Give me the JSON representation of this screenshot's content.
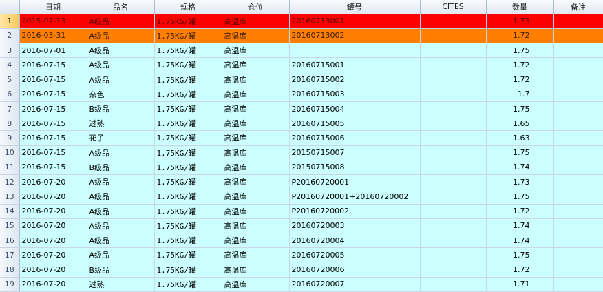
{
  "colors": {
    "row_default": "#ccffff",
    "row_red": "#ff0000",
    "row_orange": "#ff8000",
    "header": "#dfe8f3"
  },
  "columns": [
    "日期",
    "品名",
    "规格",
    "仓位",
    "罐号",
    "CITES",
    "数量",
    "备注"
  ],
  "rows": [
    {
      "n": "1",
      "date": "2015-07-13",
      "name": "A级品",
      "spec": "1.75KG/罐",
      "loc": "高温库",
      "can": "20160713001",
      "cites": "",
      "qty": "1.73",
      "note": "",
      "status": "red"
    },
    {
      "n": "2",
      "date": "2016-03-31",
      "name": "A级品",
      "spec": "1.75KG/罐",
      "loc": "高温库",
      "can": "20160713002",
      "cites": "",
      "qty": "1.72",
      "note": "",
      "status": "orange"
    },
    {
      "n": "3",
      "date": "2016-07-01",
      "name": "A级品",
      "spec": "1.75KG/罐",
      "loc": "高温库",
      "can": "",
      "cites": "",
      "qty": "1.75",
      "note": "",
      "status": "normal"
    },
    {
      "n": "4",
      "date": "2016-07-15",
      "name": "A级品",
      "spec": "1.75KG/罐",
      "loc": "高温库",
      "can": "20160715001",
      "cites": "",
      "qty": "1.72",
      "note": "",
      "status": "normal"
    },
    {
      "n": "5",
      "date": "2016-07-15",
      "name": "A级品",
      "spec": "1.75KG/罐",
      "loc": "高温库",
      "can": "20160715002",
      "cites": "",
      "qty": "1.72",
      "note": "",
      "status": "normal"
    },
    {
      "n": "6",
      "date": "2016-07-15",
      "name": "杂色",
      "spec": "1.75KG/罐",
      "loc": "高温库",
      "can": "20160715003",
      "cites": "",
      "qty": "1.7",
      "note": "",
      "status": "normal"
    },
    {
      "n": "7",
      "date": "2016-07-15",
      "name": "B级品",
      "spec": "1.75KG/罐",
      "loc": "高温库",
      "can": "20160715004",
      "cites": "",
      "qty": "1.75",
      "note": "",
      "status": "normal"
    },
    {
      "n": "8",
      "date": "2016-07-15",
      "name": "过熟",
      "spec": "1.75KG/罐",
      "loc": "高温库",
      "can": "20160715005",
      "cites": "",
      "qty": "1.65",
      "note": "",
      "status": "normal"
    },
    {
      "n": "9",
      "date": "2016-07-15",
      "name": "花子",
      "spec": "1.75KG/罐",
      "loc": "高温库",
      "can": "20160715006",
      "cites": "",
      "qty": "1.63",
      "note": "",
      "status": "normal"
    },
    {
      "n": "10",
      "date": "2016-07-15",
      "name": "A级品",
      "spec": "1.75KG/罐",
      "loc": "高温库",
      "can": "20150715007",
      "cites": "",
      "qty": "1.75",
      "note": "",
      "status": "normal"
    },
    {
      "n": "11",
      "date": "2016-07-15",
      "name": "B级品",
      "spec": "1.75KG/罐",
      "loc": "高温库",
      "can": "20150715008",
      "cites": "",
      "qty": "1.74",
      "note": "",
      "status": "normal"
    },
    {
      "n": "12",
      "date": "2016-07-20",
      "name": "A级品",
      "spec": "1.75KG/罐",
      "loc": "高温库",
      "can": "P20160720001",
      "cites": "",
      "qty": "1.73",
      "note": "",
      "status": "normal"
    },
    {
      "n": "13",
      "date": "2016-07-20",
      "name": "A级品",
      "spec": "1.75KG/罐",
      "loc": "高温库",
      "can": "P20160720001+20160720002",
      "cites": "",
      "qty": "1.75",
      "note": "",
      "status": "normal"
    },
    {
      "n": "14",
      "date": "2016-07-20",
      "name": "A级品",
      "spec": "1.75KG/罐",
      "loc": "高温库",
      "can": "P20160720002",
      "cites": "",
      "qty": "1.72",
      "note": "",
      "status": "normal"
    },
    {
      "n": "15",
      "date": "2016-07-20",
      "name": "A级品",
      "spec": "1.75KG/罐",
      "loc": "高温库",
      "can": "20160720003",
      "cites": "",
      "qty": "1.74",
      "note": "",
      "status": "normal"
    },
    {
      "n": "16",
      "date": "2016-07-20",
      "name": "A级品",
      "spec": "1.75KG/罐",
      "loc": "高温库",
      "can": "20160720004",
      "cites": "",
      "qty": "1.74",
      "note": "",
      "status": "normal"
    },
    {
      "n": "17",
      "date": "2016-07-20",
      "name": "A级品",
      "spec": "1.75KG/罐",
      "loc": "高温库",
      "can": "20160720005",
      "cites": "",
      "qty": "1.75",
      "note": "",
      "status": "normal"
    },
    {
      "n": "18",
      "date": "2016-07-20",
      "name": "B级品",
      "spec": "1.75KG/罐",
      "loc": "高温库",
      "can": "20160720006",
      "cites": "",
      "qty": "1.72",
      "note": "",
      "status": "normal"
    },
    {
      "n": "19",
      "date": "2016-07-20",
      "name": "过熟",
      "spec": "1.75KG/罐",
      "loc": "高温库",
      "can": "20160720007",
      "cites": "",
      "qty": "1.71",
      "note": "",
      "status": "normal"
    }
  ]
}
